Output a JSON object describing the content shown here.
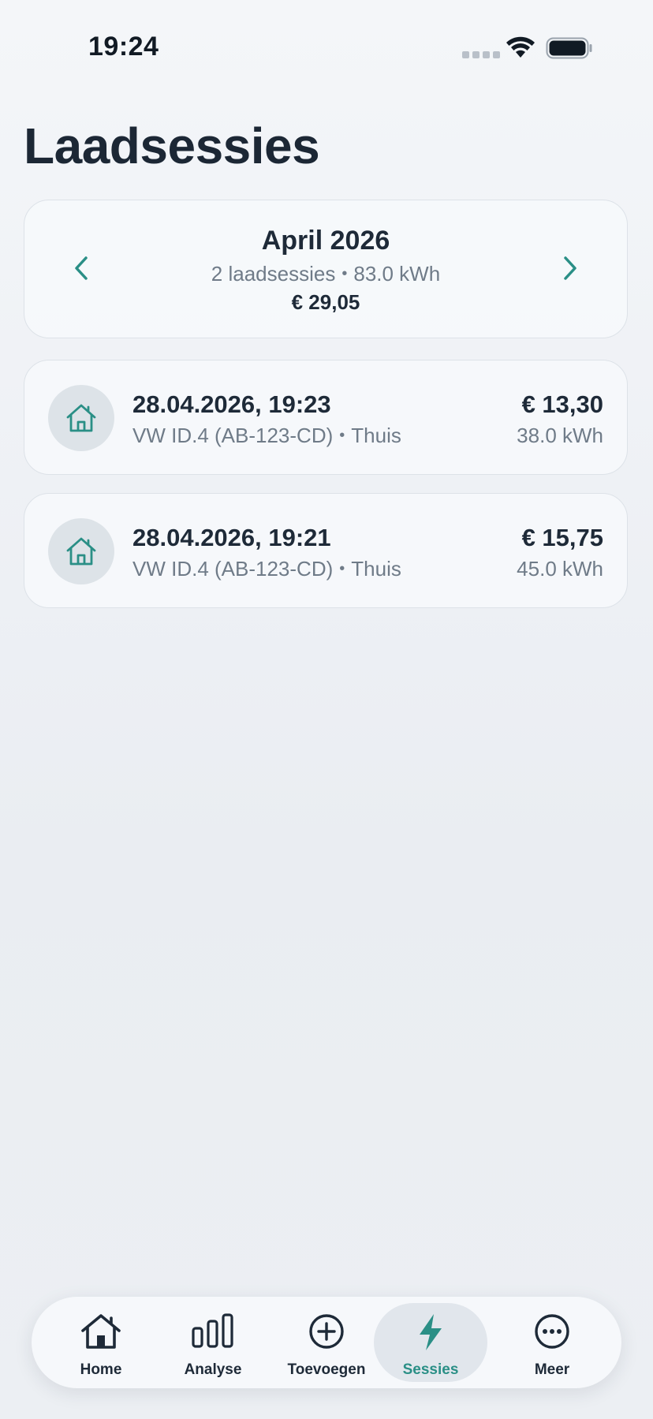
{
  "status_bar": {
    "time": "19:24"
  },
  "page": {
    "title": "Laadsessies"
  },
  "month_summary": {
    "title": "April 2026",
    "sessions_count": "2 laadsessies",
    "energy": "83.0 kWh",
    "separator": "•",
    "total": "€ 29,05"
  },
  "sessions": [
    {
      "date": "28.04.2026, 19:23",
      "vehicle": "VW ID.4 (AB-123-CD)",
      "separator": "•",
      "location": "Thuis",
      "price": "€ 13,30",
      "energy": "38.0 kWh",
      "icon": "home-icon"
    },
    {
      "date": "28.04.2026, 19:21",
      "vehicle": "VW ID.4 (AB-123-CD)",
      "separator": "•",
      "location": "Thuis",
      "price": "€ 15,75",
      "energy": "45.0 kWh",
      "icon": "home-icon"
    }
  ],
  "tab_bar": {
    "tabs": [
      {
        "label": "Home",
        "icon": "home-icon",
        "active": false
      },
      {
        "label": "Analyse",
        "icon": "bar-chart-icon",
        "active": false
      },
      {
        "label": "Toevoegen",
        "icon": "plus-circle-icon",
        "active": false
      },
      {
        "label": "Sessies",
        "icon": "bolt-icon",
        "active": true
      },
      {
        "label": "Meer",
        "icon": "more-icon",
        "active": false
      }
    ]
  },
  "colors": {
    "accent": "#2a8f86",
    "text": "#1e2a38",
    "muted": "#6f7b88"
  }
}
